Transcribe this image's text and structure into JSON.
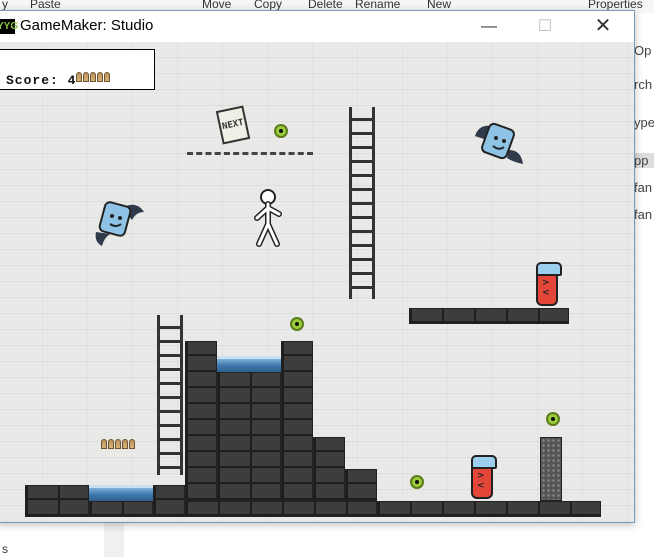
{
  "background": {
    "toolbar": [
      "y",
      "Paste",
      "Move",
      "Copy",
      "Delete",
      "Rename",
      "New",
      "Properties"
    ],
    "right_panel": [
      "Op",
      "rch",
      "ype",
      "pp",
      "fan",
      "fan"
    ],
    "left_bottom": "s"
  },
  "window": {
    "app_icon_text": "YYG",
    "title": "GameMaker: Studio",
    "controls": {
      "minimize": "—",
      "maximize": "☐",
      "close": "✕"
    }
  },
  "hud": {
    "score_label": "Score: 4",
    "ammo_count": 5
  },
  "pickups": {
    "ammo_pack_count": 5
  },
  "icons": {
    "next_sign": "NEXT",
    "enemy_face": "><"
  },
  "colors": {
    "enemy_red": "#e4473a",
    "enemy_cap": "#9bd0ef",
    "coin_green": "#9ccc3c",
    "water_blue": "#3f79ad",
    "block_dark": "#3d3d3d",
    "bat_body": "#8ec3e6"
  }
}
